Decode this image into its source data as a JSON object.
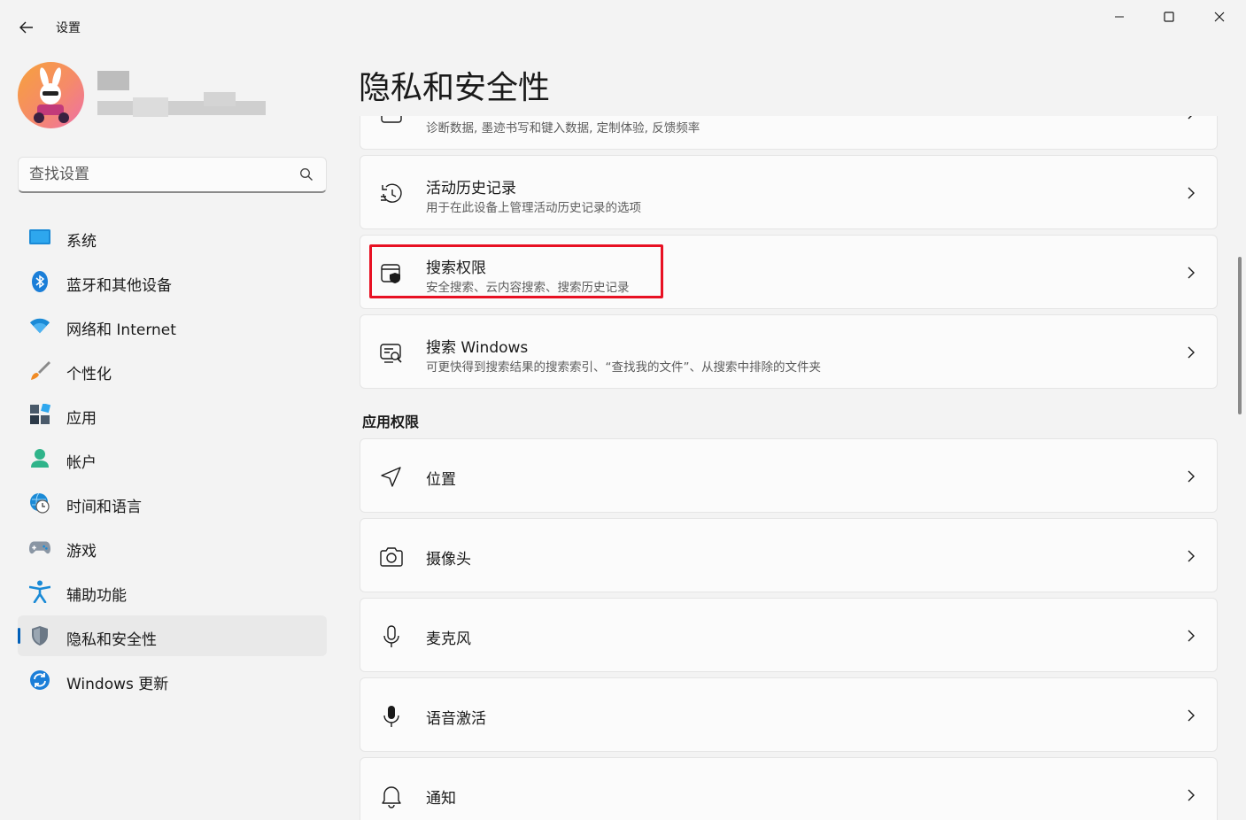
{
  "window": {
    "title": "设置"
  },
  "search": {
    "placeholder": "查找设置"
  },
  "sidebar": {
    "items": [
      {
        "label": "系统",
        "icon": "system-icon"
      },
      {
        "label": "蓝牙和其他设备",
        "icon": "bluetooth-icon"
      },
      {
        "label": "网络和 Internet",
        "icon": "wifi-icon"
      },
      {
        "label": "个性化",
        "icon": "brush-icon"
      },
      {
        "label": "应用",
        "icon": "apps-icon"
      },
      {
        "label": "帐户",
        "icon": "account-icon"
      },
      {
        "label": "时间和语言",
        "icon": "globe-clock-icon"
      },
      {
        "label": "游戏",
        "icon": "gamepad-icon"
      },
      {
        "label": "辅助功能",
        "icon": "accessibility-icon"
      },
      {
        "label": "隐私和安全性",
        "icon": "shield-icon",
        "active": true
      },
      {
        "label": "Windows 更新",
        "icon": "update-icon"
      }
    ]
  },
  "main": {
    "title": "隐私和安全性",
    "cards_top": [
      {
        "subtitle": "诊断数据, 墨迹书写和键入数据, 定制体验, 反馈频率",
        "icon": "diagnostics-icon"
      },
      {
        "title": "活动历史记录",
        "subtitle": "用于在此设备上管理活动历史记录的选项",
        "icon": "history-icon"
      },
      {
        "title": "搜索权限",
        "subtitle": "安全搜索、云内容搜索、搜索历史记录",
        "icon": "search-permissions-icon"
      },
      {
        "title": "搜索 Windows",
        "subtitle": "可更快得到搜索结果的搜索索引、“查找我的文件”、从搜索中排除的文件夹",
        "icon": "search-windows-icon"
      }
    ],
    "section_app_permissions": "应用权限",
    "cards_app": [
      {
        "title": "位置",
        "icon": "location-icon"
      },
      {
        "title": "摄像头",
        "icon": "camera-icon"
      },
      {
        "title": "麦克风",
        "icon": "microphone-icon"
      },
      {
        "title": "语音激活",
        "icon": "voice-activation-icon"
      },
      {
        "title": "通知",
        "icon": "notification-icon"
      }
    ]
  },
  "colors": {
    "accent": "#005fb8",
    "highlight": "#e81123",
    "background": "#f3f3f3",
    "card": "#fbfbfb"
  }
}
